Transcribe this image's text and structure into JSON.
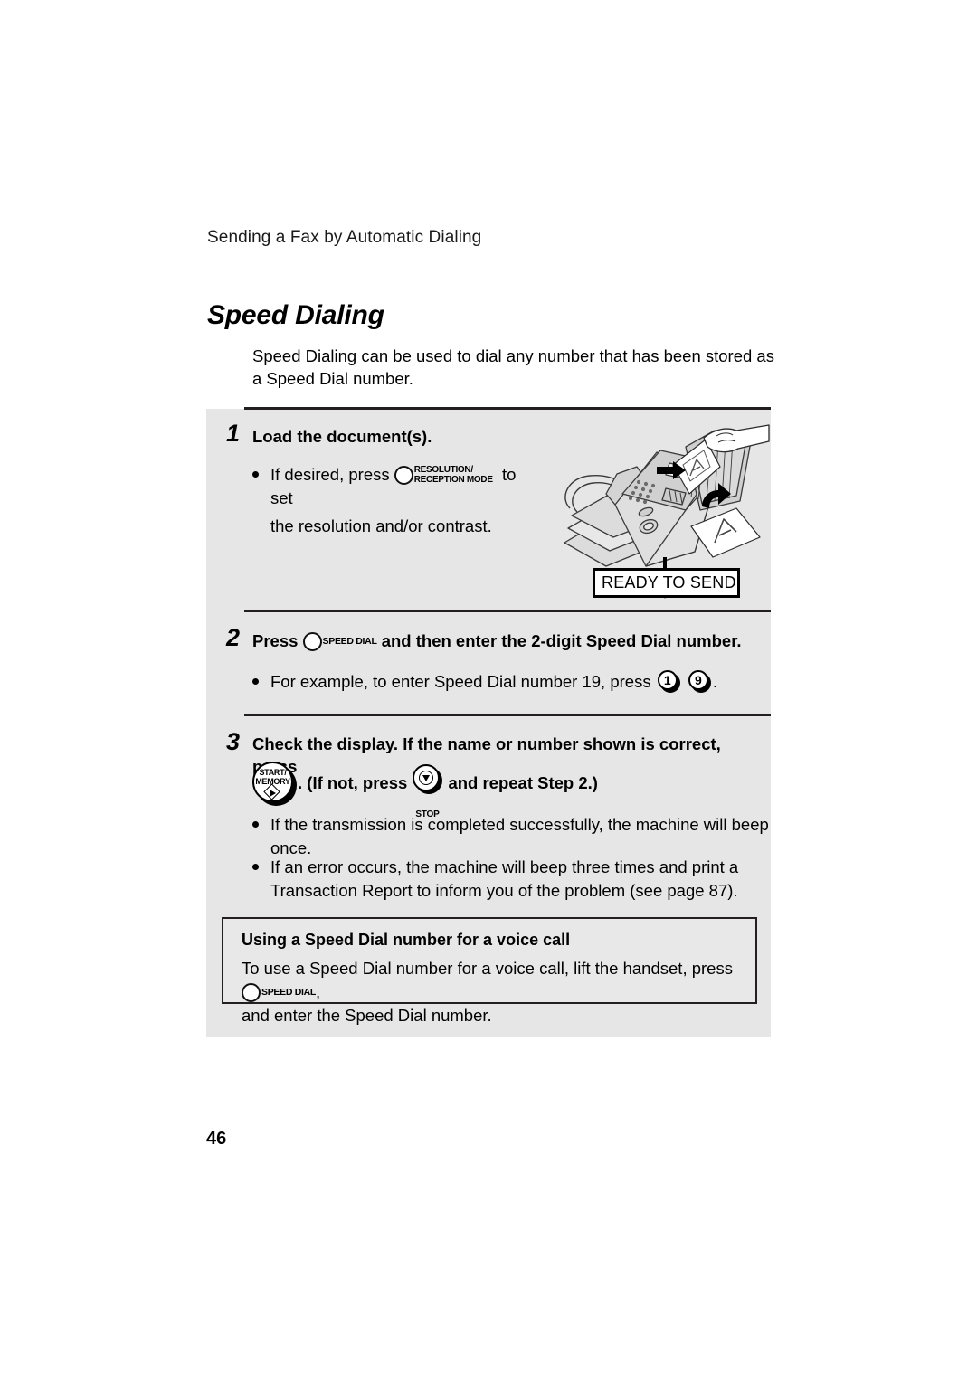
{
  "document": {
    "running_header": "Sending a Fax by Automatic Dialing",
    "section_title": "Speed Dialing",
    "intro": "Speed Dialing can be used to dial any number that has been stored as a Speed Dial number.",
    "page_number": "46"
  },
  "steps": [
    {
      "number": "1",
      "heading": "Load the document(s).",
      "bullet_pre": "If desired, press",
      "button": {
        "name": "resolution-reception-mode-button",
        "label_line1": "RESOLUTION/",
        "label_line2": "RECEPTION MODE"
      },
      "bullet_post": "to set",
      "bullet_line2": "the resolution and/or contrast.",
      "illustration": {
        "name": "fax-machine-loading-document",
        "display_text": "READY TO SEND"
      }
    },
    {
      "number": "2",
      "heading_pre": "Press",
      "button": {
        "name": "speed-dial-button",
        "label": "SPEED DIAL"
      },
      "heading_post": "and then enter the 2-digit Speed Dial number.",
      "bullet_pre": "For example, to enter Speed Dial number 19, press",
      "keys": [
        "1",
        "9"
      ],
      "bullet_post": "."
    },
    {
      "number": "3",
      "heading": "Check the display. If the name or number shown is correct, press",
      "start_button": {
        "name": "start-memory-button",
        "label_line1": "START/",
        "label_line2": "MEMORY"
      },
      "mid_text": ". (If not, press",
      "stop_button": {
        "name": "stop-button",
        "label": "STOP"
      },
      "end_text": "and repeat Step 2.)",
      "bullets": [
        "If the transmission is completed successfully, the machine will beep once.",
        "If an error occurs, the machine will beep three times and print a Transaction Report to inform you of the problem (see page 87)."
      ]
    }
  ],
  "note": {
    "title": "Using a Speed Dial number for a voice call",
    "text_pre": "To use a Speed Dial number for a voice call, lift the handset, press",
    "button": {
      "name": "speed-dial-button",
      "label": "SPEED DIAL"
    },
    "text_post": ",",
    "text_line2": "and enter the Speed Dial number."
  },
  "colors": {
    "panel_gray": "#e6e6e6",
    "note_gray": "#e8e8e8",
    "ink": "#000000"
  }
}
